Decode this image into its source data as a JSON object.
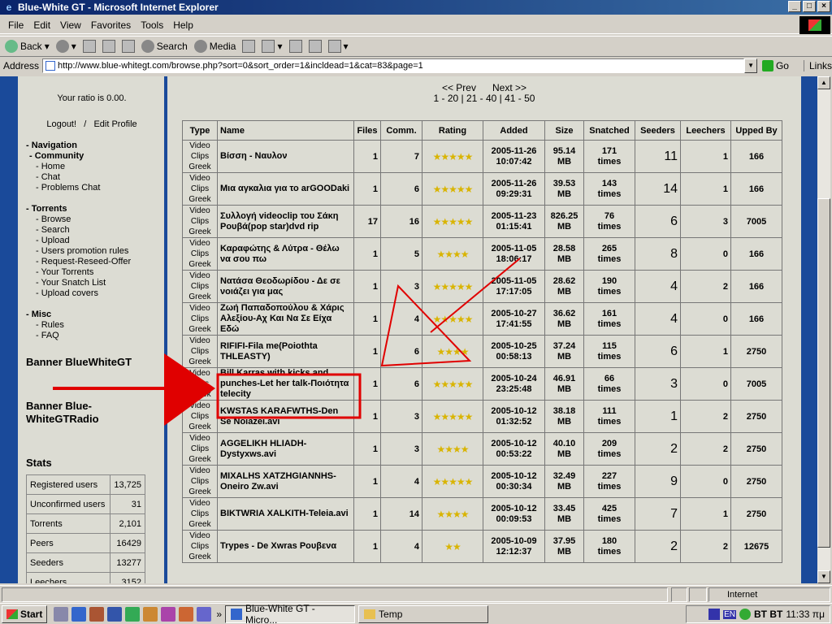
{
  "window": {
    "title": "Blue-White GT - Microsoft Internet Explorer"
  },
  "menu": [
    "File",
    "Edit",
    "View",
    "Favorites",
    "Tools",
    "Help"
  ],
  "toolbar": {
    "back": "Back",
    "search": "Search",
    "media": "Media"
  },
  "address": {
    "label": "Address",
    "url": "http://www.blue-whitegt.com/browse.php?sort=0&sort_order=1&incldead=1&cat=83&page=1",
    "go": "Go",
    "links": "Links"
  },
  "sidebar": {
    "ratio": "Your ratio is 0.00.",
    "logout": "Logout!",
    "edit_profile": "Edit Profile",
    "separator": "/",
    "navigation": "- Navigation",
    "community": "- Community",
    "community_items": [
      "- Home",
      "- Chat",
      "- Problems Chat"
    ],
    "torrents": "- Torrents",
    "torrents_items": [
      "- Browse",
      "- Search",
      "- Upload",
      "- Users promotion rules",
      "- Request-Reseed-Offer",
      "- Your Torrents",
      "- Your Snatch List",
      "- Upload covers"
    ],
    "misc": "- Misc",
    "misc_items": [
      "- Rules",
      "- FAQ"
    ],
    "banner1": "Banner BlueWhiteGT",
    "banner2": "Banner Blue-WhiteGTRadio",
    "stats_title": "Stats",
    "stats": [
      {
        "label": "Registered users",
        "value": "13,725"
      },
      {
        "label": "Unconfirmed users",
        "value": "31"
      },
      {
        "label": "Torrents",
        "value": "2,101"
      },
      {
        "label": "Peers",
        "value": "16429"
      },
      {
        "label": "Seeders",
        "value": "13277"
      },
      {
        "label": "Leechers",
        "value": "3152"
      }
    ]
  },
  "pager": {
    "prev": "<< Prev",
    "next": "Next >>",
    "pages": "1 - 20 | 21 - 40 | 41 - 50"
  },
  "table": {
    "headers": [
      "Type",
      "Name",
      "Files",
      "Comm.",
      "Rating",
      "Added",
      "Size",
      "Snatched",
      "Seeders",
      "Leechers",
      "Upped By"
    ],
    "type_lines": [
      "Video",
      "Clips",
      "Greek"
    ],
    "rows": [
      {
        "name": "Βίσση - Ναυλον",
        "files": "1",
        "comm": "7",
        "stars": "★★★★★",
        "date": "2005-11-26",
        "time": "10:07:42",
        "size_n": "95.14",
        "size_u": "MB",
        "snatched": "171",
        "times": "times",
        "seeders": "11",
        "leechers": "1",
        "upped": "166"
      },
      {
        "name": "Μια αγκαλια για το arGOODaki",
        "files": "1",
        "comm": "6",
        "stars": "★★★★★",
        "date": "2005-11-26",
        "time": "09:29:31",
        "size_n": "39.53",
        "size_u": "MB",
        "snatched": "143",
        "times": "times",
        "seeders": "14",
        "leechers": "1",
        "upped": "166"
      },
      {
        "name": "Συλλογή videoclip του Σάκη Ρουβά(pop star)dvd rip",
        "files": "17",
        "comm": "16",
        "stars": "★★★★★",
        "date": "2005-11-23",
        "time": "01:15:41",
        "size_n": "826.25",
        "size_u": "MB",
        "snatched": "76",
        "times": "times",
        "seeders": "6",
        "leechers": "3",
        "upped": "7005"
      },
      {
        "name": "Καραφώτης & Λύτρα - Θέλω να σου πω",
        "files": "1",
        "comm": "5",
        "stars": "★★★★",
        "date": "2005-11-05",
        "time": "18:06:17",
        "size_n": "28.58",
        "size_u": "MB",
        "snatched": "265",
        "times": "times",
        "seeders": "8",
        "leechers": "0",
        "upped": "166"
      },
      {
        "name": "Νατάσα Θεοδωρίδου - Δε σε νοιάζει για μας",
        "files": "1",
        "comm": "3",
        "stars": "★★★★★",
        "date": "2005-11-05",
        "time": "17:17:05",
        "size_n": "28.62",
        "size_u": "MB",
        "snatched": "190",
        "times": "times",
        "seeders": "4",
        "leechers": "2",
        "upped": "166"
      },
      {
        "name": "Ζωή Παπαδοπούλου & Χάρις Αλεξίου-Αχ Και Να Σε Είχα Εδώ",
        "files": "1",
        "comm": "4",
        "stars": "★★★★★",
        "date": "2005-10-27",
        "time": "17:41:55",
        "size_n": "36.62",
        "size_u": "MB",
        "snatched": "161",
        "times": "times",
        "seeders": "4",
        "leechers": "0",
        "upped": "166"
      },
      {
        "name": "RIFIFI-Fila me(Poiothta THLEASTY)",
        "files": "1",
        "comm": "6",
        "stars": "★★★★",
        "date": "2005-10-25",
        "time": "00:58:13",
        "size_n": "37.24",
        "size_u": "MB",
        "snatched": "115",
        "times": "times",
        "seeders": "6",
        "leechers": "1",
        "upped": "2750"
      },
      {
        "name": "Bill Karras with kicks and punches-Let her talk-Ποιότητα telecity",
        "files": "1",
        "comm": "6",
        "stars": "★★★★★",
        "date": "2005-10-24",
        "time": "23:25:48",
        "size_n": "46.91",
        "size_u": "MB",
        "snatched": "66",
        "times": "times",
        "seeders": "3",
        "leechers": "0",
        "upped": "7005"
      },
      {
        "name": "KWSTAS KARAFWTHS-Den Se Noiazei.avi",
        "files": "1",
        "comm": "3",
        "stars": "★★★★★",
        "date": "2005-10-12",
        "time": "01:32:52",
        "size_n": "38.18",
        "size_u": "MB",
        "snatched": "111",
        "times": "times",
        "seeders": "1",
        "leechers": "2",
        "upped": "2750"
      },
      {
        "name": "AGGELIKH HLIADH-Dystyxws.avi",
        "files": "1",
        "comm": "3",
        "stars": "★★★★",
        "date": "2005-10-12",
        "time": "00:53:22",
        "size_n": "40.10",
        "size_u": "MB",
        "snatched": "209",
        "times": "times",
        "seeders": "2",
        "leechers": "2",
        "upped": "2750"
      },
      {
        "name": "MIXALHS XATZHGIANNHS-Oneiro Zw.avi",
        "files": "1",
        "comm": "4",
        "stars": "★★★★★",
        "date": "2005-10-12",
        "time": "00:30:34",
        "size_n": "32.49",
        "size_u": "MB",
        "snatched": "227",
        "times": "times",
        "seeders": "9",
        "leechers": "0",
        "upped": "2750"
      },
      {
        "name": "BIKTWRIA XALKITH-Teleia.avi",
        "files": "1",
        "comm": "14",
        "stars": "★★★★",
        "date": "2005-10-12",
        "time": "00:09:53",
        "size_n": "33.45",
        "size_u": "MB",
        "snatched": "425",
        "times": "times",
        "seeders": "7",
        "leechers": "1",
        "upped": "2750"
      },
      {
        "name": "Trypes - De Xwras Ρουβενα",
        "files": "1",
        "comm": "4",
        "stars": "★★",
        "date": "2005-10-09",
        "time": "12:12:37",
        "size_n": "37.95",
        "size_u": "MB",
        "snatched": "180",
        "times": "times",
        "seeders": "2",
        "leechers": "2",
        "upped": "12675"
      }
    ]
  },
  "status": {
    "zone": "Internet"
  },
  "taskbar": {
    "start": "Start",
    "task1": "Blue-White GT - Micro...",
    "task2": "Temp",
    "tray_lang": "EN",
    "tray_text": "BT BT",
    "clock": "11:33 πμ",
    "chevron": "»"
  },
  "colors": {
    "page_blue": "#1a4a9a",
    "panel": "#dcdcd3",
    "annotation": "#e00000",
    "star": "#d9b400"
  }
}
